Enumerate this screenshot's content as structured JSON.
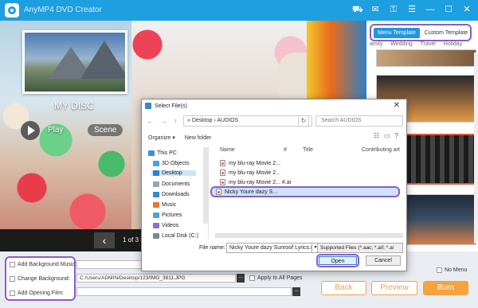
{
  "app": {
    "title": "AnyMP4 DVD Creator",
    "window_icons": [
      "cart-icon",
      "chat-icon",
      "key-icon",
      "menu-icon",
      "minimize-icon",
      "maximize-icon",
      "close-icon"
    ]
  },
  "preview": {
    "disc_title": "MY DISC",
    "play_label": "Play",
    "scene_label": "Scene",
    "page_indicator": "1 of 3 P"
  },
  "templates": {
    "tabs": [
      {
        "label": "Menu Template",
        "active": true
      },
      {
        "label": "Custom Template",
        "active": false
      }
    ],
    "categories": [
      "amily",
      "Wedding",
      "Travel",
      "Holiday"
    ]
  },
  "options": {
    "add_background_music": "Add Background Music:",
    "change_background": "Change Background:",
    "change_background_path": "C:/Users/ADMIN/Desktop/123/IMG_3811.JPG",
    "add_opening_film": "Add Opening Film:",
    "apply_to_all_pages": "Apply to All Pages",
    "no_menu": "No Menu",
    "dots": "..."
  },
  "buttons": {
    "back": "Back",
    "preview": "Preview",
    "burn": "Burn"
  },
  "dialog": {
    "title": "Select File(s)",
    "close": "✕",
    "breadcrumb": "«  Desktop  ›  AUDIOS",
    "refresh": "↻",
    "search_placeholder": "Search AUDIOS",
    "organize": "Organize ▾",
    "new_folder": "New folder",
    "nav_items": [
      {
        "label": "This PC",
        "color": "#3b8fd9"
      },
      {
        "label": "3D Objects",
        "color": "#4aa3df"
      },
      {
        "label": "Desktop",
        "color": "#2f7fc5",
        "active": true
      },
      {
        "label": "Documents",
        "color": "#9aa4b1"
      },
      {
        "label": "Downloads",
        "color": "#2f89d6"
      },
      {
        "label": "Music",
        "color": "#e07b39"
      },
      {
        "label": "Pictures",
        "color": "#4aa3df"
      },
      {
        "label": "Videos",
        "color": "#8a6fd1"
      },
      {
        "label": "Local Disk (C:)",
        "color": "#7c8796"
      }
    ],
    "columns": {
      "name": "Name",
      "number": "#",
      "title": "Title",
      "contributing": "Contributing art"
    },
    "files": [
      {
        "name": "my blu-ray Movie 2...",
        "selected": false
      },
      {
        "name": "my blu-ray Movie 2...",
        "selected": false
      },
      {
        "name": "my blu-ray Movie 2... #.ai",
        "selected": false
      },
      {
        "name": "Nicky Youre dazy  S...",
        "selected": true
      }
    ],
    "file_name_label": "File name:",
    "file_name_value": "Nicky Youre dazy  Sunroof Lyrics.n",
    "filter_value": "Supported Files (*.aac; *.aif; *.ai",
    "open": "Open",
    "cancel": "Cancel"
  },
  "colors": {
    "titlebar": "#1e9fe0",
    "highlight": "#8d5cc7",
    "accent": "#f5a33c",
    "tab_active": "#2196e0"
  }
}
